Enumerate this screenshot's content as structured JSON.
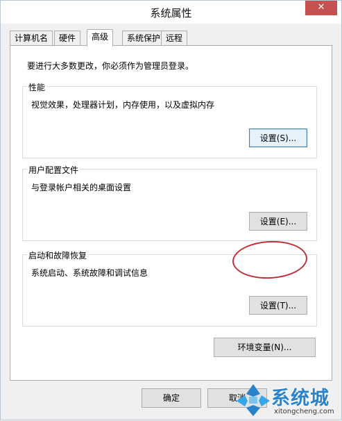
{
  "window": {
    "title": "系统属性",
    "close_label": "✕"
  },
  "tabs": [
    {
      "label": "计算机名"
    },
    {
      "label": "硬件"
    },
    {
      "label": "高级"
    },
    {
      "label": "系统保护"
    },
    {
      "label": "远程"
    }
  ],
  "active_tab": "高级",
  "panel": {
    "admin_note": "要进行大多数更改，你必须作为管理员登录。",
    "performance": {
      "title": "性能",
      "description": "视觉效果，处理器计划，内存使用，以及虚拟内存",
      "button": "设置(S)..."
    },
    "user_profiles": {
      "title": "用户配置文件",
      "description": "与登录帐户相关的桌面设置",
      "button": "设置(E)..."
    },
    "startup_recovery": {
      "title": "启动和故障恢复",
      "description": "系统启动、系统故障和调试信息",
      "button": "设置(T)..."
    },
    "env_button": "环境变量(N)..."
  },
  "footer": {
    "ok_label": "确定",
    "cancel_label": "取消"
  },
  "watermark": {
    "title": "系统城",
    "subtitle": "xitongcheng.com"
  },
  "colors": {
    "annotation": "#c0303a",
    "watermark_blue": "#2a83c9",
    "close_red": "#c75050"
  }
}
